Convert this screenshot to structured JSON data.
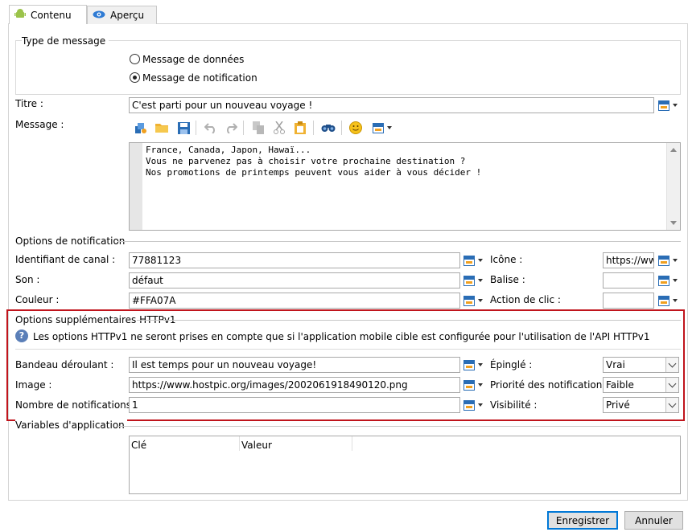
{
  "tabs": [
    {
      "label": "Contenu",
      "icon": "android-icon"
    },
    {
      "label": "Aperçu",
      "icon": "eye-icon"
    }
  ],
  "message_type": {
    "legend": "Type de message",
    "options": [
      "Message de données",
      "Message de notification"
    ],
    "selected": "Message de notification"
  },
  "title_field": {
    "label": "Titre :",
    "value": "C'est parti pour un nouveau voyage !"
  },
  "message": {
    "label": "Message :",
    "lines": [
      "France, Canada, Japon, Hawaï...",
      "Vous ne parvenez pas à choisir votre prochaine destination ?",
      "Nos promotions de printemps peuvent vous aider à vous décider !"
    ]
  },
  "toolbar_icons": [
    "insert-personalization-icon",
    "open-folder-icon",
    "save-icon",
    "undo-icon",
    "redo-icon",
    "copy-icon",
    "cut-icon",
    "paste-icon",
    "find-icon",
    "emoji-icon",
    "insert-field-icon"
  ],
  "notif_options": {
    "legend": "Options de notification",
    "channel_id": {
      "label": "Identifiant de canal :",
      "value": "77881123"
    },
    "sound": {
      "label": "Son :",
      "value": "défaut"
    },
    "color": {
      "label": "Couleur :",
      "value": "#FFA07A"
    },
    "icon": {
      "label": "Icône :",
      "value": "https://www"
    },
    "tag": {
      "label": "Balise :",
      "value": ""
    },
    "click_action": {
      "label": "Action de clic :",
      "value": ""
    }
  },
  "httpv1": {
    "legend": "Options supplémentaires HTTPv1",
    "info": "Les options HTTPv1 ne seront prises en compte que si l'application mobile cible est configurée pour l'utilisation de l'API HTTPv1",
    "ticker": {
      "label": "Bandeau déroulant :",
      "value": "Il est temps pour un nouveau voyage!"
    },
    "image": {
      "label": "Image :",
      "value": "https://www.hostpic.org/images/2002061918490120.png"
    },
    "count": {
      "label": "Nombre de notifications :",
      "value": "1"
    },
    "sticky": {
      "label": "Épinglé :",
      "value": "Vrai"
    },
    "priority": {
      "label": "Priorité des notifications :",
      "value": "Faible"
    },
    "visibility": {
      "label": "Visibilité :",
      "value": "Privé"
    }
  },
  "app_vars": {
    "legend": "Variables d'application",
    "columns": [
      "Clé",
      "Valeur"
    ]
  },
  "buttons": {
    "save": "Enregistrer",
    "cancel": "Annuler"
  },
  "colors": {
    "highlight": "#c0141c",
    "accent": "#0078d7"
  }
}
